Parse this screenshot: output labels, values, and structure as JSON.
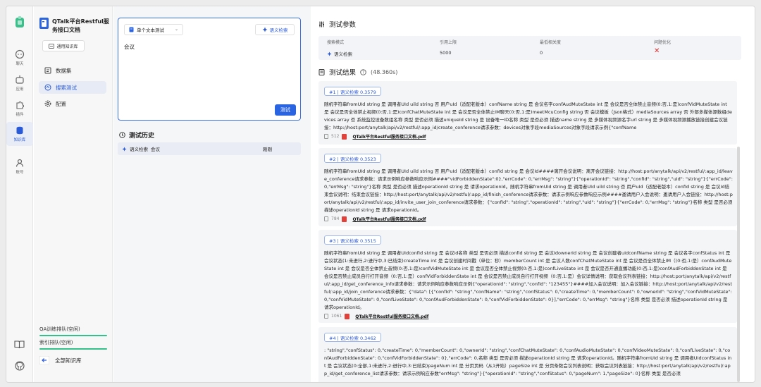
{
  "rail": {
    "items": [
      {
        "label": "聊天"
      },
      {
        "label": "应用"
      },
      {
        "label": "插件"
      },
      {
        "label": "知识库"
      },
      {
        "label": "账号"
      }
    ]
  },
  "sidebar": {
    "kb_title": "QTalk平台Restful服务接口文档",
    "kb_tag": "通用知识库",
    "nav": [
      {
        "label": "数据集"
      },
      {
        "label": "搜索测试"
      },
      {
        "label": "配置"
      }
    ],
    "queues": [
      {
        "label": "QA训练排队(空闲)"
      },
      {
        "label": "索引排队(空闲)"
      }
    ],
    "back_label": "全部知识库"
  },
  "test": {
    "mode_select": "单个文本测试",
    "semantic_button": "语义检索",
    "query": "会议",
    "test_button": "测试",
    "history_title": "测试历史",
    "history": [
      {
        "mode": "语义检索",
        "query": "会议",
        "time": "刚刚"
      }
    ]
  },
  "params": {
    "title": "测试参数",
    "headers": [
      "搜索模式",
      "引用上限",
      "最低相关度",
      "问题优化"
    ],
    "values": {
      "mode": "语义检索",
      "limit": "5000",
      "min_score": "0"
    }
  },
  "results": {
    "title": "测试结果",
    "elapsed": "(48.360s)",
    "items": [
      {
        "tag": "#1 | 语义检索 0.3579",
        "text": "随机字符串fromUId string 是 调用者UId uild string 否 用户uId（适配老版本）confName string 是 会议名字confAudMuteState int 是 会议是否全体禁止音频(0:否,1:是)confVidMuteState int 是 会议是否全体禁止视频(0:否,1:是)confChatMuteState int 是 会议是否全体禁止IM聊天(0:否,1:是)meetMcuConfig string 否 会议模板（json格式）mediaSources array 否 外部多媒体源数组devices array 否 系统监控设备数组名称 类型 是否必须 描述uniqueId string 是 设备唯一ID名称 类型 是否必须 描述name string 是 多媒体视频源名字url string 是 多媒体视频源播放链接创建会议链接：http://host:port/anytalk/api/v2/restful/:app_id/create_conference请求参数：devices对象字段mediaSources对象字段请求示例{\"confName",
        "count": "512",
        "file": "QTalk平台Restful服务接口文档.pdf"
      },
      {
        "tag": "#2 | 语义检索 0.3523",
        "text": "随机字符串fromUId string 是 调用者UId uild string 否 用户uId（适配老版本）confId string 是 会议Id####离开会议说明：离开会议链接：http://host:port/anytalk/api/v2/restful/:app_id/leave_conference请求参数：请求示例响应参数响应示例####\"vidForbiddenState\":0},\"errCode\": 0,\"errMsg\": \"string\"}{\"operationId\": \"string\",\"confId\": \"string\",\"uId\": \"string\"}{\"errCode\": 0,\"errMsg\": \"string\"}名称 类型 是否必须 描述operationId string 是 请求operationId。随机字符串fromUId string 是 调用者UId uild string 否 用户uId（适配老版本）confId string 是 会议Id结束会议说明：结束会议链接：http://host:port/anytalk/api/v2/restful/:app_id/finish_conference请求参数：请求示例响应参数响应示例####邀请用户入会说明：邀请用户入会链接：http://host:port/anytalk/api/v2/restful/:app_id/invite_user_join_conference请求参数：{\"confId\": \"string\",\"operationId\": \"string\",\"uId\": \"string\"}{\"errCode\": 0,\"errMsg\": \"string\"}名称 类型 是否必须 描述operationId string 是 请求operationId。",
        "count": "784",
        "file": "QTalk平台Restful服务接口文档.pdf"
      },
      {
        "tag": "#3 | 语义检索 0.3515",
        "text": "随机字符串fromUId string 是 调用者UIdconfId string 是 会议id名称 类型 是否必须 描述confId string 是 会议IdownerId string 是 会议创建者uIdconfName string 是 会议名字confStatus int 是 会议状态(1:未进行,2:进行中,3:已结束)createTime int 是 会议创建时间戳（单位：秒）memberCount int 是 会议人数confChatMuteState int 是 会议是否全体禁止IM（(0:否,1:是）confAudMuteState int 是 会议是否全体禁止音频(0:否,1:是)confVidMuteState int 是 会议是否全体禁止视频(0:否,1:是)confLiveState int 是 会议是否开通直播功能(0:否,1:是)confAudForbiddenState int 是 会议是否禁止成员自行打开音频（0:否,1:是）confVidForbiddenState int 是 会议是否禁止成员自行打开视频（0:否,1:是）会议详情说明：获取会议列表链接：http://host:port/anytalk/api/v2/restful/:app_id/get_conference_info请求参数：请求示例响应参数响应示例{\"operationId\": \"string\",\"confId\": \"123455\"}####加入会议说明：加入会议链接：http://host:port/anytalk/api/v2/restful/:app_id/join_conference请求参数：{\"data\": [{\"confId\": \"string\",\"confName\": \"string\",\"confStatus\": 0,\"createTime\": 0,\"memberCount\": 0,\"ownerId\": \"string\",\"confVidMuteState\": 0,\"confVidMuteState\": 0,\"confLiveState\": 0,\"confAudForbiddenState\": 0,\"confVidForbiddenState\": 0}],\"errCode\": 0,\"errMsg\": \"string\"}名称 类型 是否必须 描述operationId string 是 请求operationId。",
        "count": "1061",
        "file": "QTalk平台Restful服务接口文档.pdf"
      },
      {
        "tag": "#4 | 语义检索 0.3462",
        "text": ": \"string\",\"confStatus\": 0,\"createTime\": 0,\"memberCount\": 0,\"ownerId\": \"string\",\"confChatMuteState\": 0,\"confAudioMuteState\": 0,\"confVideoMuteState\": 0,\"confLiveState\": 0,\"confAudForbiddenState\": 0,\"confVidForbiddenState\": 0},\"errCode\": 0,名称 类型 是否必须 描述operationId string 是 请求operationId。随机字符串fromUId string 是 调用者UIdconfStatus int 是 会议状态(0:全部,1:未进行,2:进行中,3:已结束)pageNum int 是 分页页码（从1开始）pageSize int 是 分页条数会议列表说明：获取会议列表链接：http://host:port/anytalk/api/v2/restful/:app_id/get_conference_list请求参数：请求示例响应参数\"errMsg\": \"string\"}{\"operationId\": \"string\",\"confStatus\": 0,\"pageNum\": 1,\"pageSize\": 0}名称 类型 是否必须",
        "count": "",
        "file": ""
      }
    ]
  },
  "colors": {
    "accent": "#2b64e0",
    "success": "#33c08a",
    "danger": "#e02b2b",
    "pdf": "#e0413a"
  }
}
